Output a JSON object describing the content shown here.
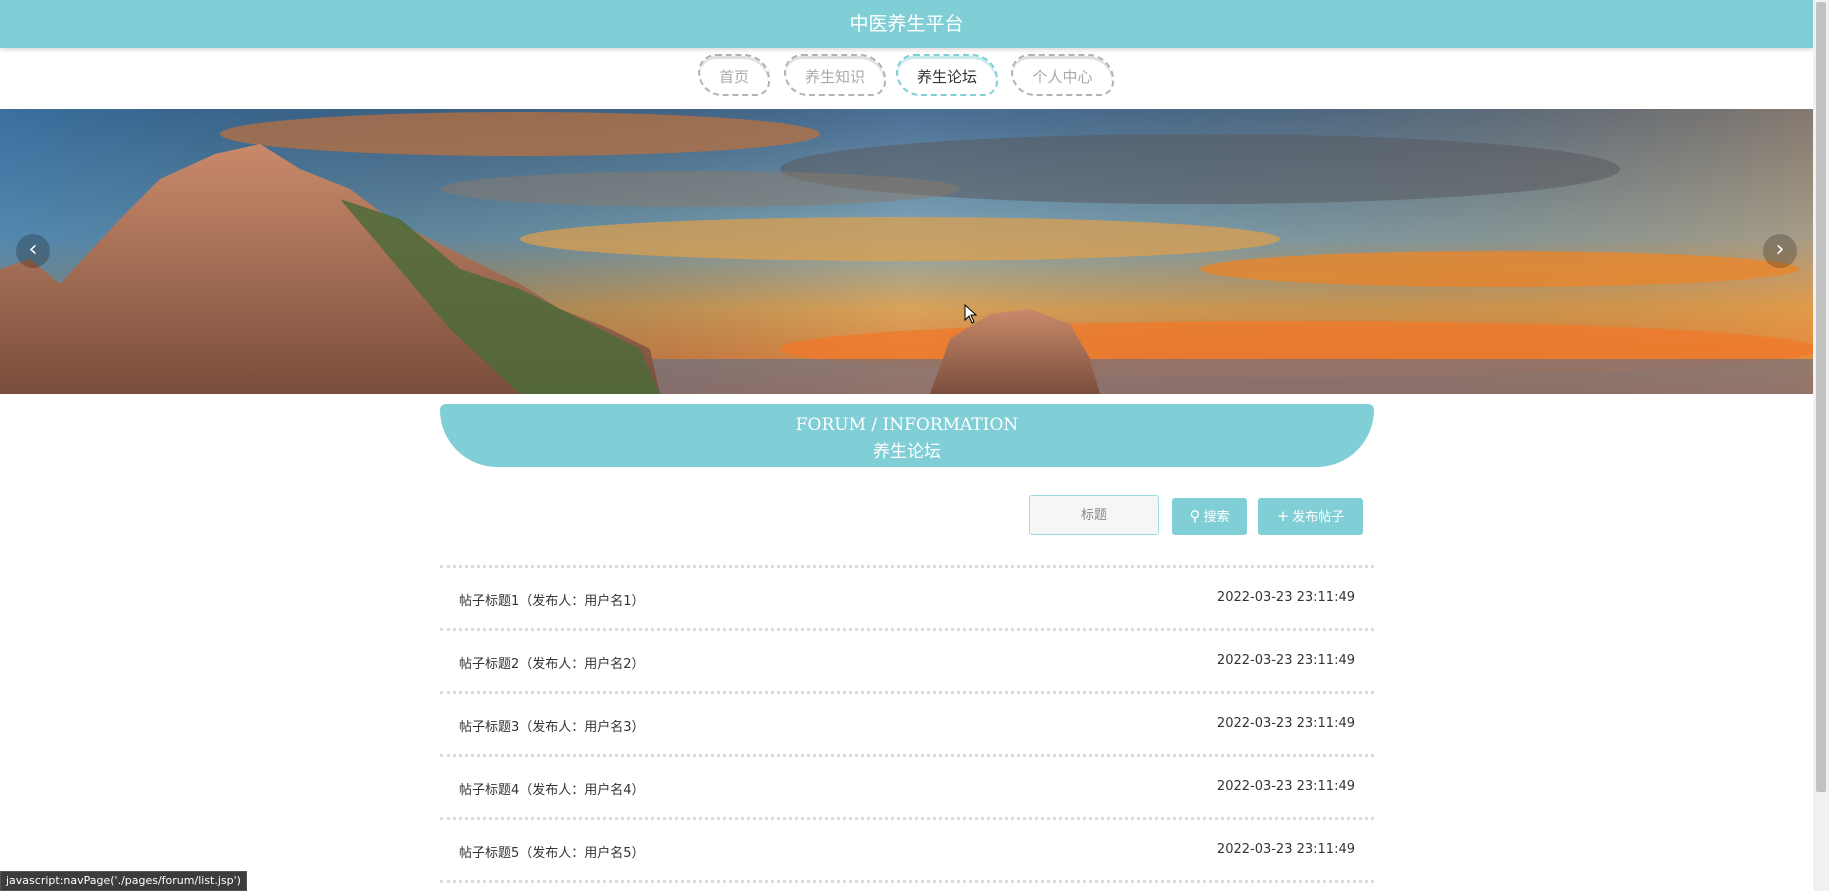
{
  "header": {
    "title": "中医养生平台"
  },
  "nav": {
    "items": [
      {
        "label": "首页",
        "active": false
      },
      {
        "label": "养生知识",
        "active": false
      },
      {
        "label": "养生论坛",
        "active": true
      },
      {
        "label": "个人中心",
        "active": false
      }
    ]
  },
  "banner": {
    "prev_icon": "chevron-left-icon",
    "next_icon": "chevron-right-icon"
  },
  "section": {
    "title_en": "FORUM / INFORMATION",
    "title_cn": "养生论坛"
  },
  "search": {
    "placeholder": "标题",
    "search_label": "搜索",
    "post_label": "发布帖子"
  },
  "posts": [
    {
      "title": "帖子标题1（发布人：用户名1）",
      "time": "2022-03-23 23:11:49"
    },
    {
      "title": "帖子标题2（发布人：用户名2）",
      "time": "2022-03-23 23:11:49"
    },
    {
      "title": "帖子标题3（发布人：用户名3）",
      "time": "2022-03-23 23:11:49"
    },
    {
      "title": "帖子标题4（发布人：用户名4）",
      "time": "2022-03-23 23:11:49"
    },
    {
      "title": "帖子标题5（发布人：用户名5）",
      "time": "2022-03-23 23:11:49"
    }
  ],
  "status_bar": {
    "text": "javascript:navPage('./pages/forum/list.jsp')"
  },
  "colors": {
    "accent": "#80cfd6",
    "text": "#333333",
    "muted": "#aaaaaa"
  }
}
